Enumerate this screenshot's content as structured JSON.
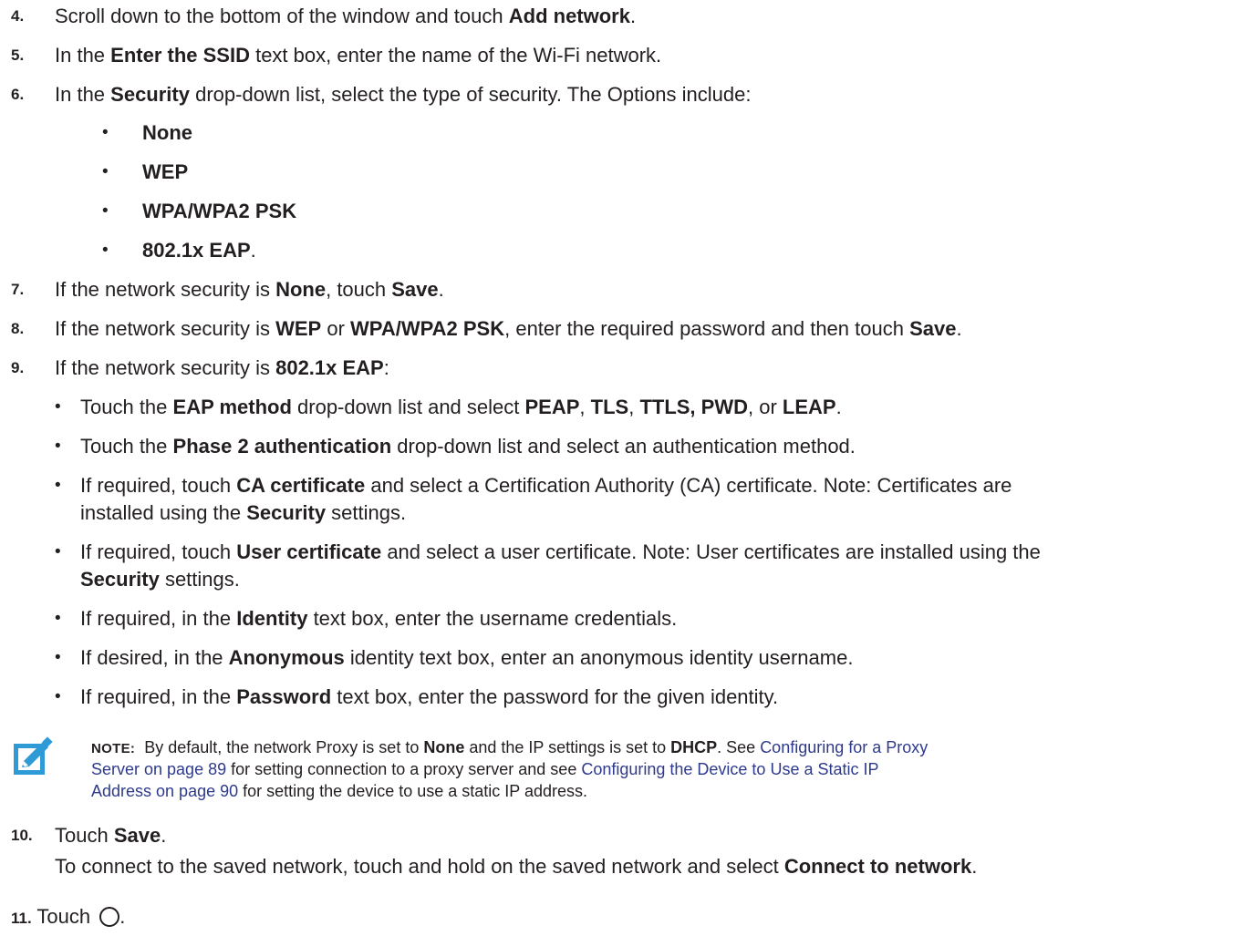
{
  "step4": {
    "num": "4.",
    "pre": "Scroll down to the bottom of the window and touch ",
    "b1": "Add network",
    "post": "."
  },
  "step5": {
    "num": "5.",
    "pre": "In the ",
    "b1": "Enter the SSID",
    "post": " text box, enter the name of the Wi-Fi network."
  },
  "step6": {
    "num": "6.",
    "pre": "In the ",
    "b1": "Security",
    "post": " drop-down list, select the type of security. The Options include:"
  },
  "security_options": [
    "None",
    "WEP",
    "WPA/WPA2 PSK",
    "802.1x EAP"
  ],
  "bullet_char": "•",
  "step7": {
    "num": "7.",
    "pre": "If the network security is ",
    "b1": "None",
    "mid": ", touch ",
    "b2": "Save",
    "post": "."
  },
  "step8": {
    "num": "8.",
    "pre": "If the network security is ",
    "b1": "WEP",
    "mid1": " or ",
    "b2": "WPA/WPA2 PSK",
    "mid2": ", enter the required password and then touch ",
    "b3": "Save",
    "post": "."
  },
  "step9": {
    "num": "9.",
    "pre": "If the network security is ",
    "b1": "802.1x EAP",
    "post": ":"
  },
  "eap": {
    "b1": {
      "pre": "Touch the ",
      "eap_method": "EAP method",
      "mid": " drop-down list and select ",
      "peap": "PEAP",
      "c1": ", ",
      "tls": "TLS",
      "c2": ", ",
      "ttls": "TTLS,",
      "c3": " ",
      "pwd": "PWD",
      "c4": ", or ",
      "leap": "LEAP",
      "post": "."
    },
    "b2": {
      "pre": "Touch the ",
      "bold": "Phase 2 authentication",
      "post": " drop-down list and select an authentication method."
    },
    "b3": {
      "pre": "If required, touch ",
      "bold": "CA certificate",
      "post": " and select a Certification Authority (CA) certificate. Note: Certificates are",
      "l2_pre": "installed using the ",
      "l2_bold": "Security",
      "l2_post": " settings."
    },
    "b4": {
      "pre": "If required, touch ",
      "bold": "User certificate",
      "post": " and select a user certificate. Note: User certificates are installed using the",
      "l2_bold": "Security",
      "l2_post": " settings."
    },
    "b5": {
      "pre": "If required, in the ",
      "bold": "Identity",
      "post": " text box, enter the username credentials."
    },
    "b6": {
      "pre": "If desired, in the ",
      "bold": "Anonymous",
      "post": " identity text box, enter an anonymous identity username."
    },
    "b7": {
      "pre": "If required, in the ",
      "bold": "Password",
      "post": " text box, enter the password for the given identity."
    }
  },
  "note": {
    "label": "NOTE:",
    "t1": "By default, the network Proxy is set to ",
    "none": "None",
    "t2": " and the IP settings is set to ",
    "dhcp": "DHCP",
    "t3": ". See ",
    "link1a": "Configuring for a Proxy",
    "link1b": "Server on page 89",
    "t4": " for setting connection to a proxy server and see ",
    "link2a": "Configuring the Device to Use a Static IP",
    "link2b": "Address on page 90",
    "t5": " for setting the device to use a static IP address."
  },
  "step10": {
    "num": "10.",
    "pre": "Touch ",
    "b1": "Save",
    "post": ".",
    "l2_pre": "To connect to the saved network, touch and hold on the saved network and select ",
    "l2_bold": "Connect to network",
    "l2_post": "."
  },
  "step11": {
    "num": "11.",
    "pre": "Touch ",
    "post": "."
  },
  "icons": {
    "note": "note-pencil-icon",
    "home": "home-button-icon"
  }
}
